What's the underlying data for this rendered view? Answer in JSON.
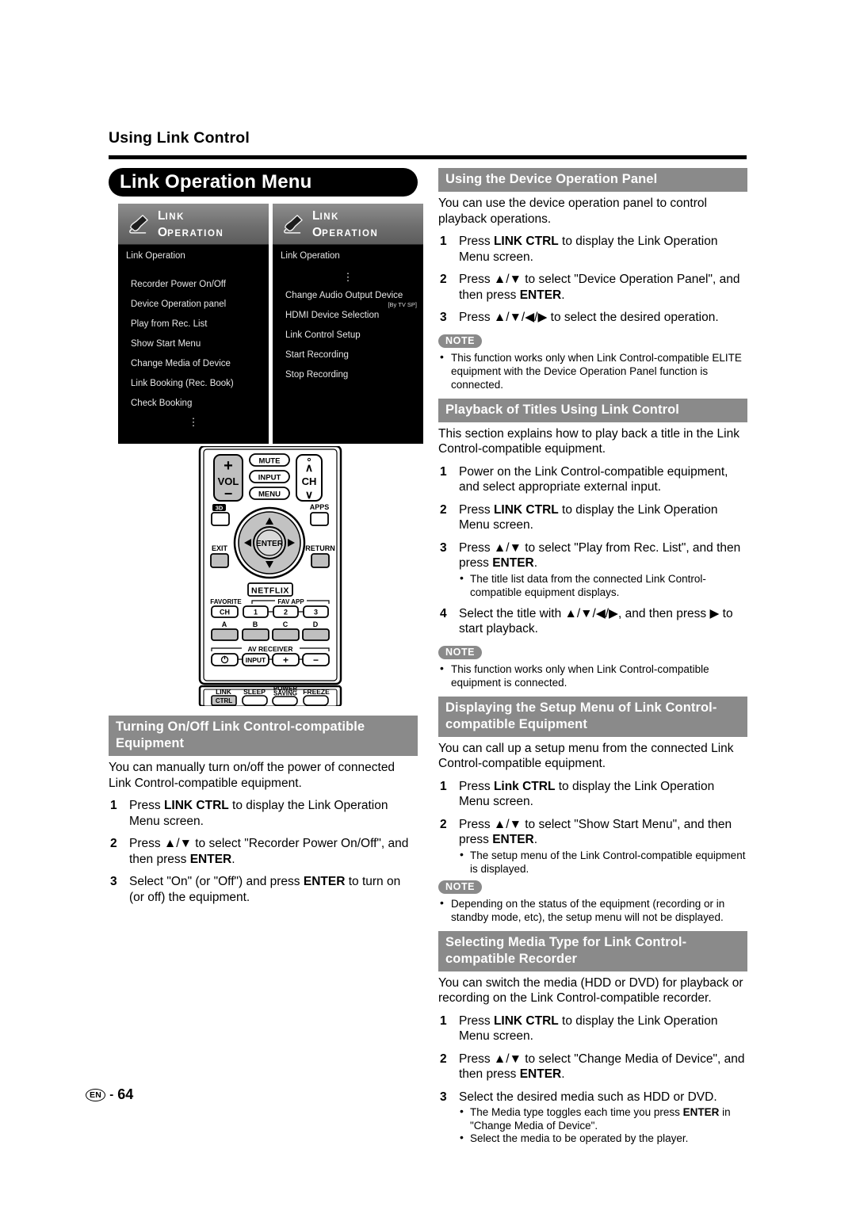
{
  "running_head": "Using Link Control",
  "page_title": "Link Operation Menu",
  "footer": {
    "lang_code": "EN",
    "dash": "-",
    "page_number": "64"
  },
  "menu_screens": [
    {
      "logo_line1_cap": "L",
      "logo_line1_rest": "INK",
      "logo_line2_cap": "O",
      "logo_line2_rest": "PERATION",
      "screen_label": "Link Operation",
      "top_ellipsis": false,
      "items": [
        {
          "label": "Recorder Power On/Off",
          "sub": ""
        },
        {
          "label": "Device Operation panel",
          "sub": ""
        },
        {
          "label": "Play from Rec. List",
          "sub": ""
        },
        {
          "label": "Show Start Menu",
          "sub": ""
        },
        {
          "label": "Change Media of Device",
          "sub": ""
        },
        {
          "label": "Link Booking (Rec. Book)",
          "sub": ""
        },
        {
          "label": "Check Booking",
          "sub": ""
        }
      ],
      "bottom_ellipsis": true
    },
    {
      "logo_line1_cap": "L",
      "logo_line1_rest": "INK",
      "logo_line2_cap": "O",
      "logo_line2_rest": "PERATION",
      "screen_label": "Link Operation",
      "top_ellipsis": true,
      "items": [
        {
          "label": "Change Audio Output Device",
          "sub": "[By TV SP]"
        },
        {
          "label": "HDMI Device Selection",
          "sub": ""
        },
        {
          "label": "Link Control Setup",
          "sub": ""
        },
        {
          "label": "Start Recording",
          "sub": ""
        },
        {
          "label": "Stop Recording",
          "sub": ""
        }
      ],
      "bottom_ellipsis": false
    }
  ],
  "remote": {
    "vol_plus": "+",
    "vol_label": "VOL",
    "vol_minus": "−",
    "mute": "MUTE",
    "input": "INPUT",
    "menu": "MENU",
    "ch_up": "∧",
    "ch_label": "CH",
    "ch_down": "∨",
    "three_d": "3D",
    "apps": "APPS",
    "exit": "EXIT",
    "return": "RETURN",
    "enter": "ENTER",
    "netflix": "NETFLIX",
    "favorite": "FAVORITE",
    "favorite_ch": "CH",
    "fav_app": "FAV APP",
    "fav_app_1": "1",
    "fav_app_2": "2",
    "fav_app_3": "3",
    "color_a": "A",
    "color_b": "B",
    "color_c": "C",
    "color_d": "D",
    "av_receiver": "AV RECEIVER",
    "av_power": "⏻",
    "av_input": "INPUT",
    "av_plus": "+",
    "av_minus": "−",
    "link": "LINK",
    "link_ctrl": "CTRL",
    "sleep": "SLEEP",
    "power_saving_l1": "POWER",
    "power_saving_l2": "SAVING",
    "freeze": "FREEZE"
  },
  "sections": {
    "turning_onoff": {
      "heading_line1": "Turning On/Off Link Control-compatible",
      "heading_line2": "Equipment",
      "intro": "You can manually turn on/off the power of connected Link Control-compatible equipment.",
      "steps": [
        {
          "num": "1",
          "pre": "Press ",
          "bold": "LINK CTRL",
          "post": " to display the Link Operation Menu screen."
        },
        {
          "num": "2",
          "pre": "Press ▲/▼ to select \"Recorder Power On/Off\", and then press ",
          "bold": "ENTER",
          "post": "."
        },
        {
          "num": "3",
          "pre": "Select \"On\" (or \"Off\") and press ",
          "bold": "ENTER",
          "post": " to turn on (or off) the equipment."
        }
      ]
    },
    "device_operation_panel": {
      "heading": "Using the Device Operation Panel",
      "intro": "You can use the device operation panel to control playback operations.",
      "steps": [
        {
          "num": "1",
          "pre": "Press ",
          "bold": "LINK CTRL",
          "post": " to display the Link Operation Menu screen."
        },
        {
          "num": "2",
          "pre": "Press ▲/▼ to select \"Device Operation Panel\", and then press ",
          "bold": "ENTER",
          "post": "."
        },
        {
          "num": "3",
          "pre": "Press ▲/▼/◀/▶ to select the desired operation.",
          "bold": "",
          "post": ""
        }
      ],
      "note_badge": "NOTE",
      "notes": [
        "This function works only when Link Control-compatible ELITE equipment with the Device Operation Panel function is connected."
      ]
    },
    "playback_titles": {
      "heading": "Playback of Titles Using Link Control",
      "intro": "This section explains how to play back a title in the Link Control-compatible equipment.",
      "steps": [
        {
          "num": "1",
          "pre": "Power on the Link Control-compatible equipment, and select appropriate external input.",
          "bold": "",
          "post": ""
        },
        {
          "num": "2",
          "pre": "Press ",
          "bold": "LINK CTRL",
          "post": " to display the Link Operation Menu screen."
        },
        {
          "num": "3",
          "pre": "Press ▲/▼ to select \"Play from Rec. List\", and then press ",
          "bold": "ENTER",
          "post": "."
        }
      ],
      "step3_bullet": "The title list data from the connected Link Control-compatible equipment displays.",
      "step4": {
        "num": "4",
        "pre": "Select the title with ▲/▼/◀/▶, and then press ▶ to start playback.",
        "bold": "",
        "post": ""
      },
      "note_badge": "NOTE",
      "notes": [
        "This function works only when Link Control-compatible equipment is connected."
      ]
    },
    "setup_menu": {
      "heading_line1": "Displaying the Setup Menu of Link Control-",
      "heading_line2": "compatible Equipment",
      "intro": "You can call up a setup menu from the connected Link Control-compatible equipment.",
      "steps": [
        {
          "num": "1",
          "pre": "Press ",
          "bold": "Link CTRL",
          "post": " to display the Link Operation Menu screen."
        },
        {
          "num": "2",
          "pre": "Press ▲/▼ to select \"Show Start Menu\", and then press ",
          "bold": "ENTER",
          "post": "."
        }
      ],
      "step2_bullet": "The setup menu of the Link Control-compatible equipment is displayed.",
      "note_badge": "NOTE",
      "notes": [
        "Depending on the status of the equipment (recording or in standby mode, etc), the setup menu will not be displayed."
      ]
    },
    "media_type": {
      "heading_line1": "Selecting Media Type for Link Control-",
      "heading_line2": "compatible Recorder",
      "intro": "You can switch the media (HDD or DVD) for playback or recording on the Link Control-compatible recorder.",
      "steps": [
        {
          "num": "1",
          "pre": "Press ",
          "bold": "LINK CTRL",
          "post": " to display the Link Operation Menu screen."
        },
        {
          "num": "2",
          "pre": "Press ▲/▼ to select \"Change Media of Device\", and then press ",
          "bold": "ENTER",
          "post": "."
        },
        {
          "num": "3",
          "pre": "Select the desired media such as HDD or DVD.",
          "bold": "",
          "post": ""
        }
      ],
      "bullets": [
        {
          "pre": "The Media type toggles each time you press ",
          "bold": "ENTER",
          "post": " in \"Change Media of Device\"."
        },
        {
          "pre": "Select the media to be operated by the player.",
          "bold": "",
          "post": ""
        }
      ]
    }
  },
  "colors": {
    "section_head_bg": "#8a8a8a",
    "title_pill_bg": "#000000",
    "menu_bg": "#000000",
    "menu_header_grey": "#7a7a7a",
    "page_bg": "#ffffff"
  }
}
